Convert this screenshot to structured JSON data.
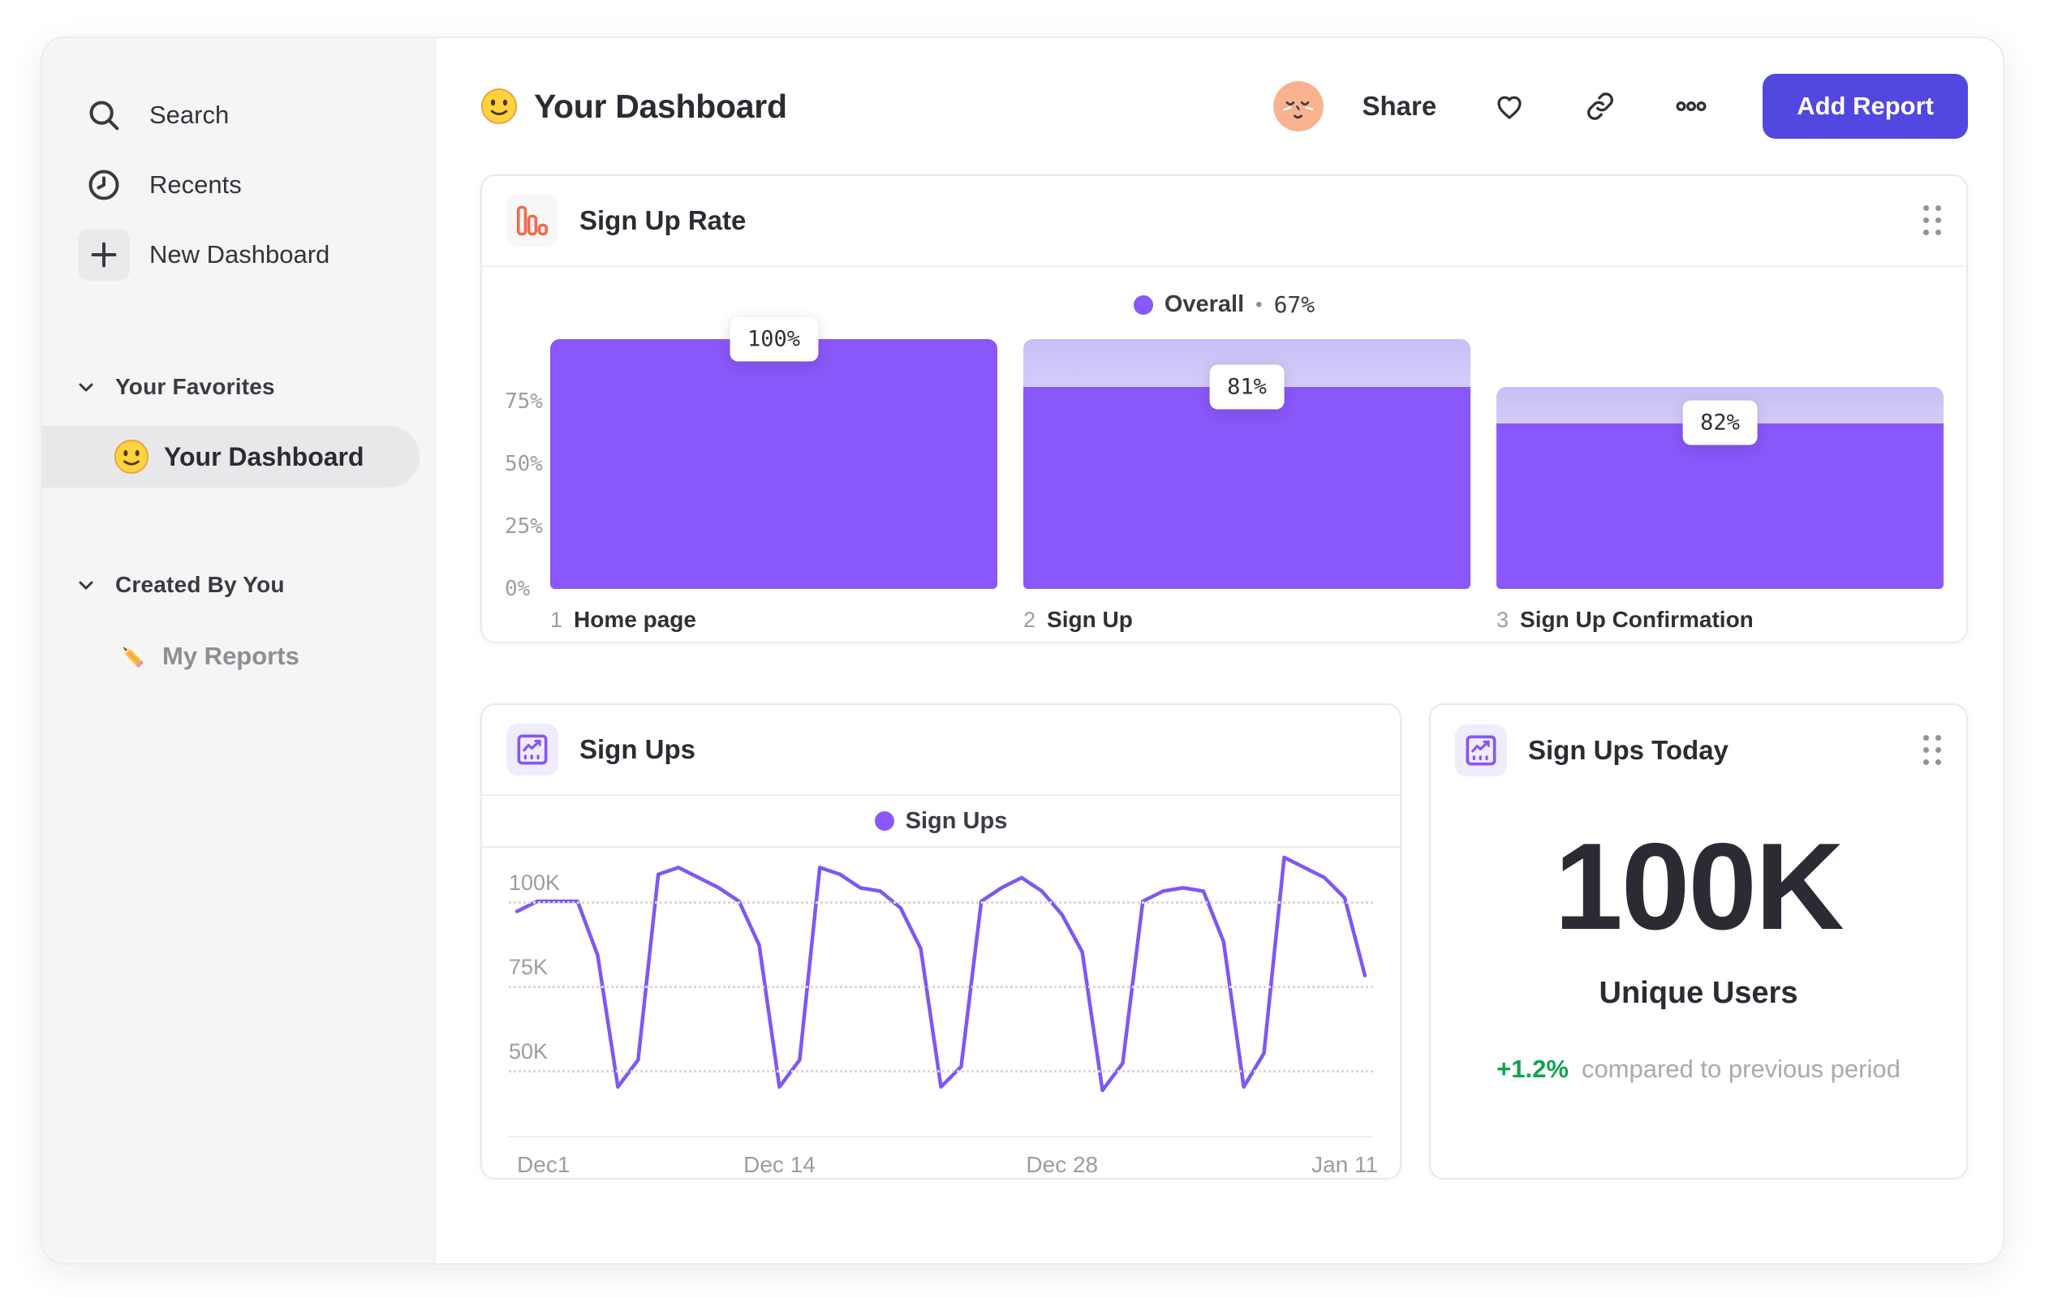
{
  "sidebar": {
    "items": [
      {
        "icon": "search-icon",
        "label": "Search"
      },
      {
        "icon": "clock-icon",
        "label": "Recents"
      },
      {
        "icon": "plus-icon",
        "label": "New Dashboard"
      }
    ],
    "sections": [
      {
        "label": "Your Favorites",
        "items": [
          {
            "icon": "smiley-emoji",
            "label": "Your Dashboard",
            "selected": true
          }
        ]
      },
      {
        "label": "Created By You",
        "items": [
          {
            "icon": "pencil-emoji",
            "label": "My Reports",
            "selected": false
          }
        ]
      }
    ]
  },
  "header": {
    "title": "Your Dashboard",
    "share_label": "Share",
    "add_report_label": "Add Report"
  },
  "cards": {
    "signup_rate": {
      "title": "Sign Up Rate",
      "legend": {
        "label": "Overall",
        "separator": "•",
        "value": "67%"
      },
      "y_ticks": [
        "75%",
        "50%",
        "25%",
        "0%"
      ],
      "steps": [
        {
          "index": "1",
          "label": "Home page",
          "conversion": "100%",
          "prev_overall_pct": 100,
          "overall_pct": 100
        },
        {
          "index": "2",
          "label": "Sign Up",
          "conversion": "81%",
          "prev_overall_pct": 100,
          "overall_pct": 81
        },
        {
          "index": "3",
          "label": "Sign Up Confirmation",
          "conversion": "82%",
          "prev_overall_pct": 81,
          "overall_pct": 66.4
        }
      ]
    },
    "signups": {
      "title": "Sign Ups",
      "legend_label": "Sign Ups",
      "y_ticks": [
        {
          "label": "100K",
          "value": 100
        },
        {
          "label": "75K",
          "value": 75
        },
        {
          "label": "50K",
          "value": 50
        }
      ],
      "x_ticks": [
        {
          "label": "Dec1",
          "day": 0
        },
        {
          "label": "Dec 14",
          "day": 13
        },
        {
          "label": "Dec 28",
          "day": 27
        },
        {
          "label": "Jan 11",
          "day": 41
        }
      ],
      "values_thousands": [
        97,
        100,
        100,
        100,
        84,
        45,
        53,
        108,
        110,
        107,
        104,
        100,
        87,
        45,
        53,
        110,
        108,
        104,
        103,
        98,
        86,
        45,
        51,
        100,
        104,
        107,
        103,
        96,
        85,
        44,
        52,
        100,
        103,
        104,
        103,
        88,
        45,
        55,
        113,
        110,
        107,
        101,
        78
      ]
    },
    "signups_today": {
      "title": "Sign Ups Today",
      "value": "100K",
      "label": "Unique Users",
      "delta": "+1.2%",
      "note": "compared to previous period"
    }
  },
  "colors": {
    "accent_button": "#5347E1",
    "series_purple": "#8A57FA",
    "line_purple": "#7E57F5",
    "funnel_icon_orange": "#F2694C",
    "delta_green": "#12A150"
  },
  "chart_data": [
    {
      "type": "bar",
      "title": "Sign Up Rate",
      "legend": "Overall • 67%",
      "categories": [
        "1 Home page",
        "2 Sign Up",
        "3 Sign Up Confirmation"
      ],
      "values": [
        100,
        81,
        82
      ],
      "overall_conversion": [
        100,
        81,
        66.4
      ],
      "ylabel": "",
      "xlabel": "",
      "ylim": [
        0,
        100
      ],
      "y_tick_labels": [
        "0%",
        "25%",
        "50%",
        "75%"
      ]
    },
    {
      "type": "line",
      "title": "Sign Ups",
      "series": [
        {
          "name": "Sign Ups",
          "values_thousands": [
            97,
            100,
            100,
            100,
            84,
            45,
            53,
            108,
            110,
            107,
            104,
            100,
            87,
            45,
            53,
            110,
            108,
            104,
            103,
            98,
            86,
            45,
            51,
            100,
            104,
            107,
            103,
            96,
            85,
            44,
            52,
            100,
            103,
            104,
            103,
            88,
            45,
            55,
            113,
            110,
            107,
            101,
            78
          ]
        }
      ],
      "x_tick_labels": [
        "Dec1",
        "Dec 14",
        "Dec 28",
        "Jan 11"
      ],
      "y_tick_labels": [
        "50K",
        "75K",
        "100K"
      ],
      "grid": "dotted-horizontal",
      "legend_position": "top-center"
    },
    {
      "type": "table",
      "title": "Sign Ups Today",
      "values": [
        {
          "metric": "Unique Users",
          "value": "100K",
          "delta": "+1.2%",
          "note": "compared to previous period"
        }
      ]
    }
  ]
}
